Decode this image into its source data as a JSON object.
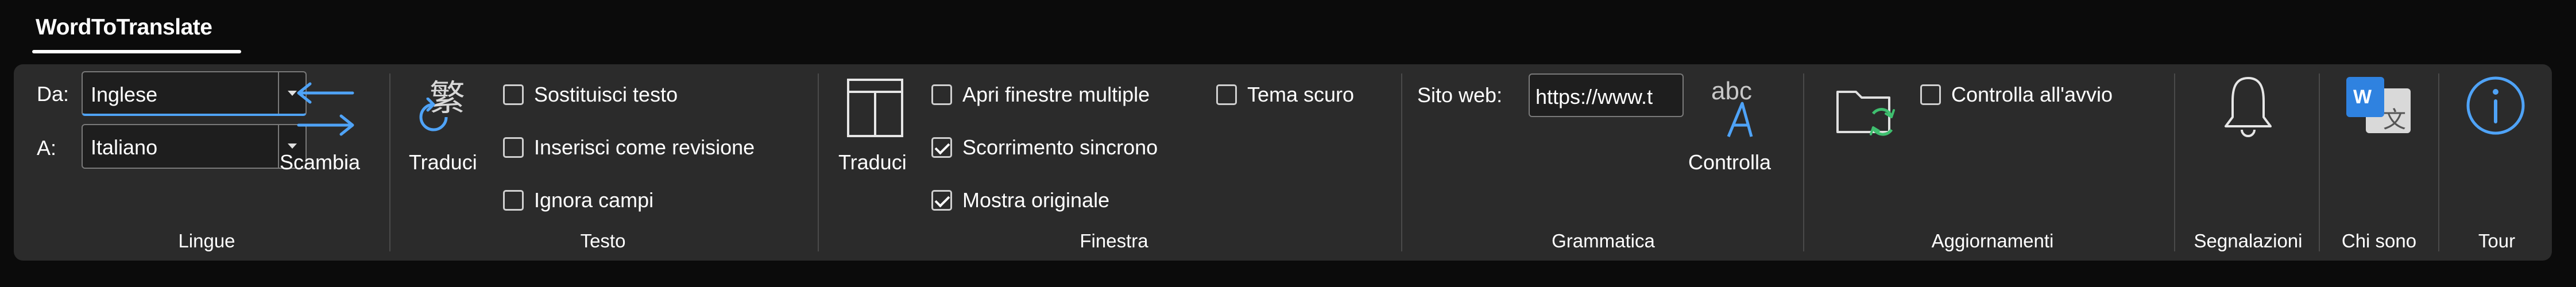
{
  "app": {
    "tab_label": "WordToTranslate"
  },
  "groups": {
    "lingue": {
      "label": "Lingue",
      "from_label": "Da:",
      "from_value": "Inglese",
      "to_label": "A:",
      "to_value": "Italiano",
      "swap_label": "Scambia"
    },
    "testo": {
      "label": "Testo",
      "translate_label": "Traduci",
      "translate_glyph": "繁",
      "options": [
        {
          "label": "Sostituisci testo",
          "checked": false
        },
        {
          "label": "Inserisci come revisione",
          "checked": false
        },
        {
          "label": "Ignora campi",
          "checked": false
        }
      ]
    },
    "finestra": {
      "label": "Finestra",
      "translate_label": "Traduci",
      "options": [
        {
          "label": "Apri finestre multiple",
          "checked": false
        },
        {
          "label": "Scorrimento sincrono",
          "checked": true
        },
        {
          "label": "Mostra originale",
          "checked": true
        }
      ],
      "dark_theme": {
        "label": "Tema scuro",
        "checked": false
      }
    },
    "grammatica": {
      "label": "Grammatica",
      "site_label": "Sito web:",
      "site_value": "https://www.t",
      "check_label": "Controlla",
      "icon_text": "abc"
    },
    "aggiornamenti": {
      "label": "Aggiornamenti",
      "startup_check": {
        "label": "Controlla all'avvio",
        "checked": false
      }
    },
    "segnalazioni": {
      "label": "Segnalazioni"
    },
    "chi_sono": {
      "label": "Chi sono",
      "icon_text": "W"
    },
    "tour": {
      "label": "Tour"
    }
  },
  "colors": {
    "background": "#0b0b0b",
    "ribbon": "#2b2b2b",
    "accent_blue": "#4fa3f7",
    "accent_green": "#3fbf6f"
  },
  "icons": {
    "swap": "swap-arrows-icon",
    "translate_text": "chinese-translate-icon",
    "window_layout": "window-split-icon",
    "grammar": "abc-grammar-icon",
    "update_folder": "folder-refresh-icon",
    "bell": "bell-icon",
    "about": "word-translate-logo-icon",
    "tour": "info-circle-icon"
  }
}
